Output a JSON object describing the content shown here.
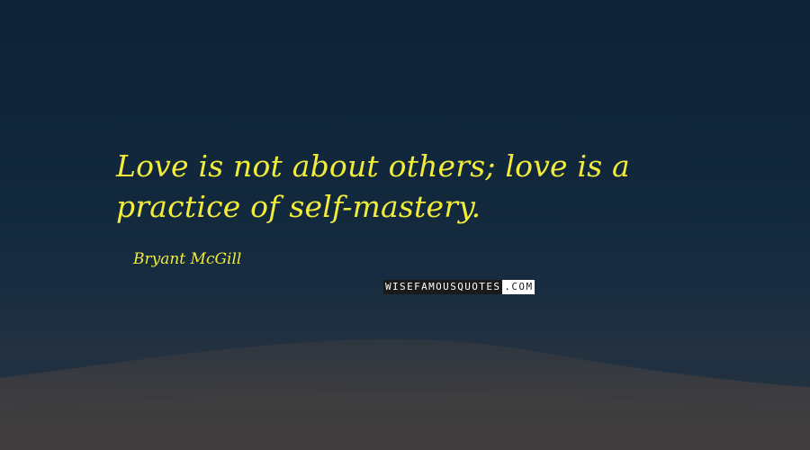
{
  "quote": {
    "text": "Love is not about others; love is a practice of self-mastery.",
    "author": "Bryant McGill"
  },
  "watermark": {
    "dark_part": "WISEFAMOUSQUOTES",
    "light_part": ".COM"
  },
  "colors": {
    "quote_text": "#f2ec3a",
    "sky_top": "#0e2236",
    "sky_bottom": "#263342",
    "dune": "#3a3a3e"
  }
}
